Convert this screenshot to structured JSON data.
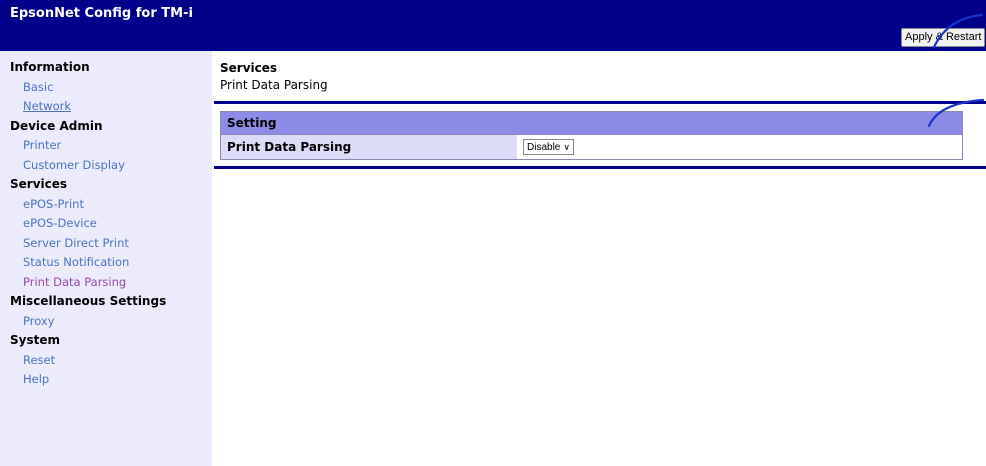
{
  "header": {
    "title": "EpsonNet Config for TM-i",
    "apply_label": "Apply & Restart"
  },
  "sidebar": {
    "sections": [
      {
        "label": "Information",
        "items": [
          "Basic",
          "Network"
        ]
      },
      {
        "label": "Device Admin",
        "items": [
          "Printer",
          "Customer Display"
        ]
      },
      {
        "label": "Services",
        "items": [
          "ePOS-Print",
          "ePOS-Device",
          "Server Direct Print",
          "Status Notification",
          "Print Data Parsing"
        ]
      },
      {
        "label": "Miscellaneous Settings",
        "items": [
          "Proxy"
        ]
      },
      {
        "label": "System",
        "items": [
          "Reset",
          "Help"
        ]
      }
    ]
  },
  "main": {
    "section_title": "Services",
    "page_subtitle": "Print Data Parsing",
    "table_header": "Setting",
    "row_label": "Print Data Parsing",
    "row_value": "Disable"
  },
  "colors": {
    "header_bg": "#00008b",
    "sidebar_bg": "#ebebfb",
    "table_header_bg": "#8c8ce6",
    "label_bg": "#dcdcf8",
    "link": "#4a73c2",
    "visited_link": "#9b4aa6"
  }
}
